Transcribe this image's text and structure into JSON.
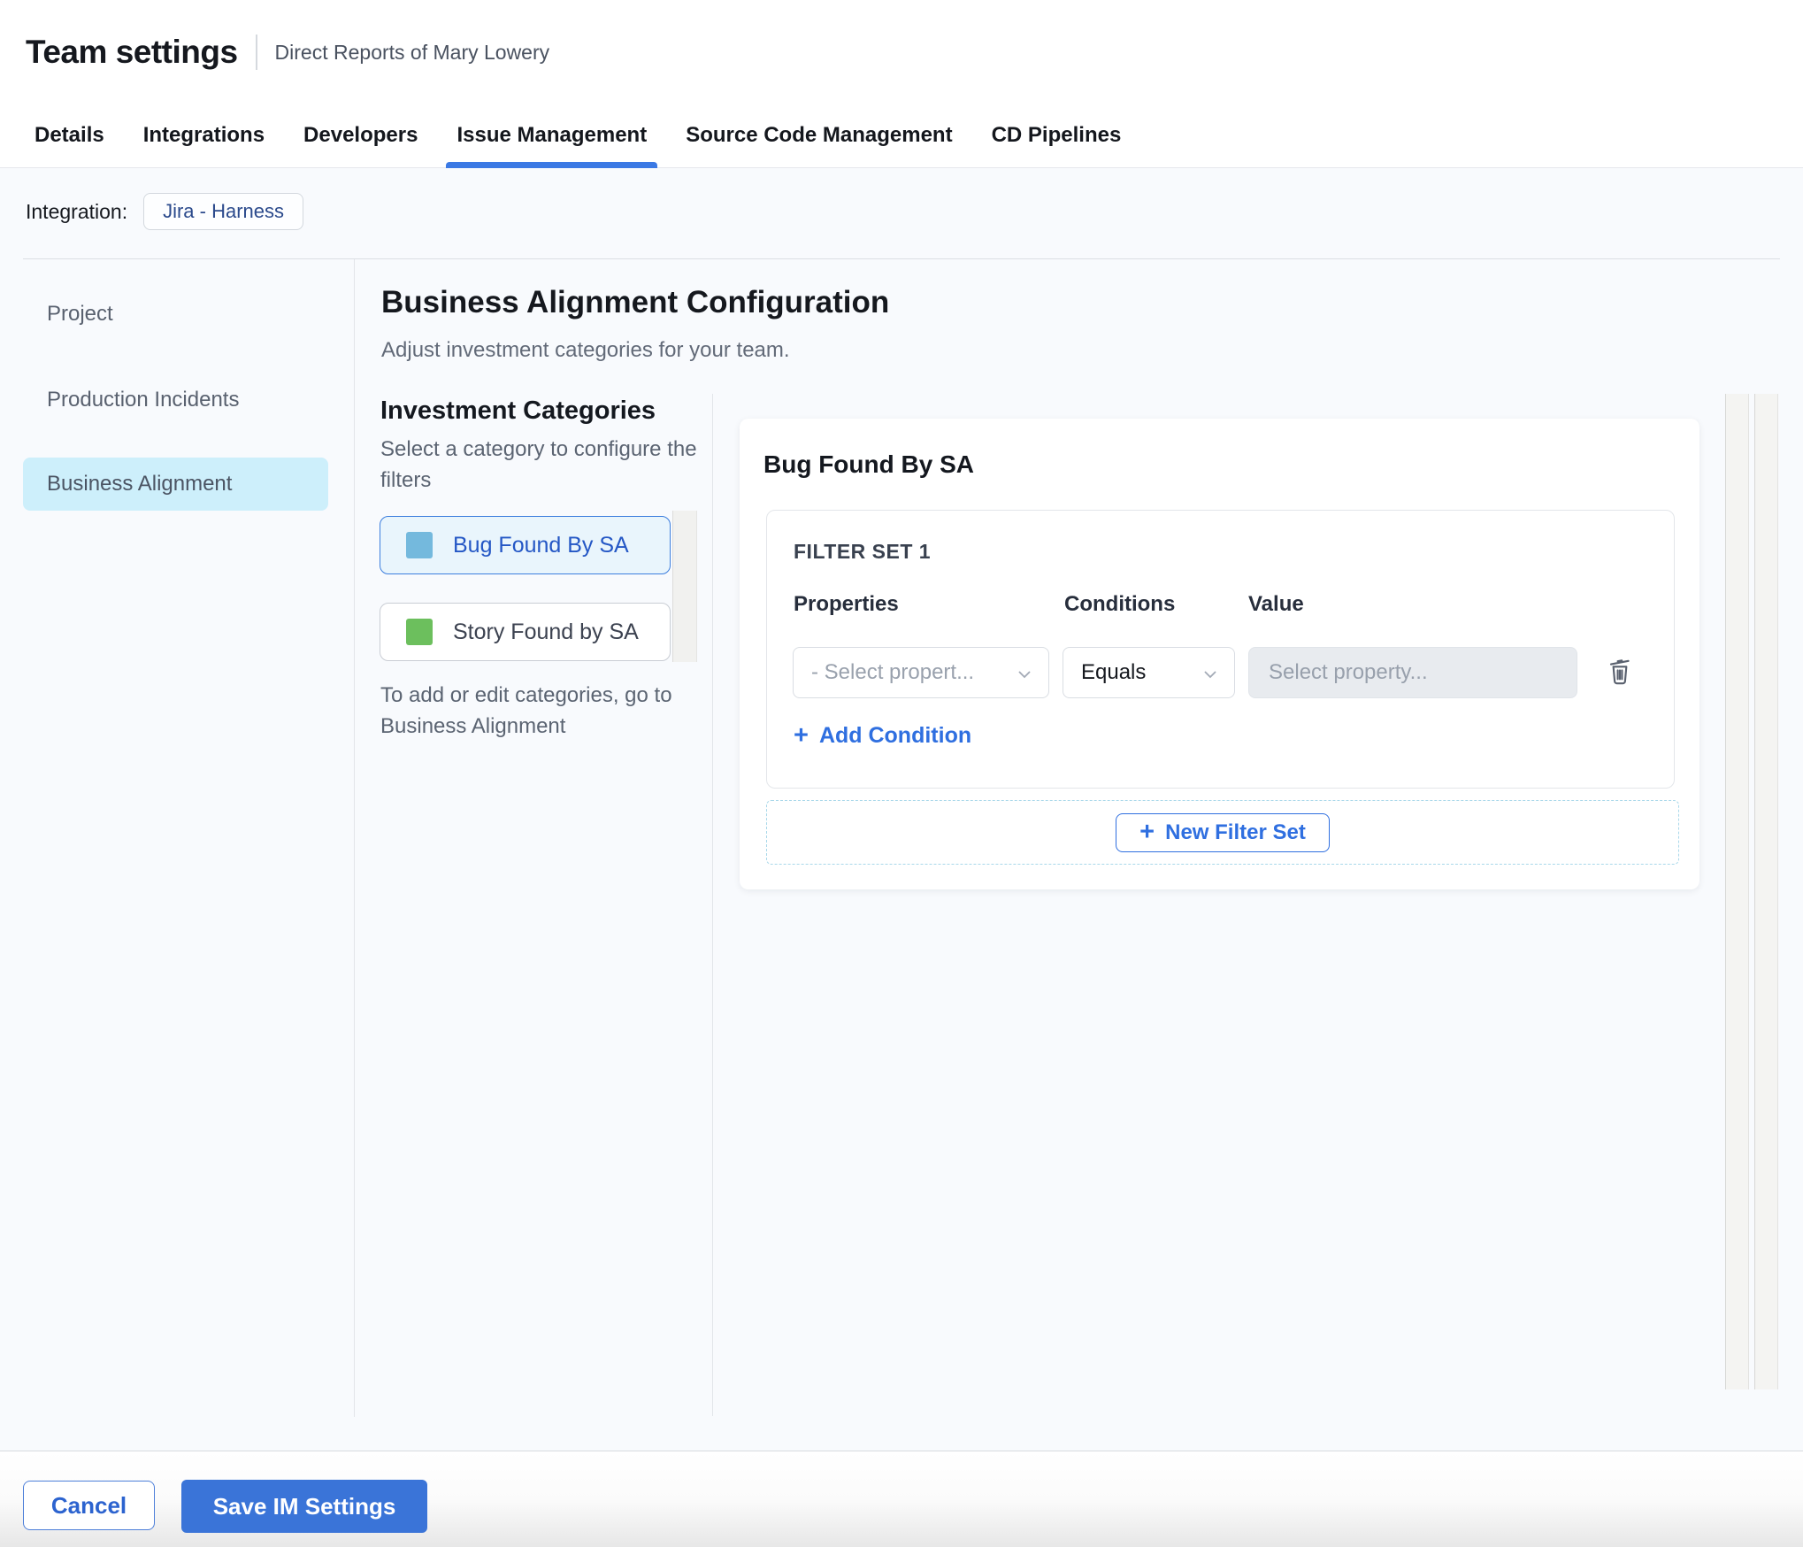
{
  "header": {
    "title": "Team settings",
    "subtitle": "Direct Reports of Mary Lowery"
  },
  "tabs": {
    "items": [
      {
        "label": "Details"
      },
      {
        "label": "Integrations"
      },
      {
        "label": "Developers"
      },
      {
        "label": "Issue Management"
      },
      {
        "label": "Source Code Management"
      },
      {
        "label": "CD Pipelines"
      }
    ],
    "active": "Issue Management"
  },
  "integration": {
    "label": "Integration:",
    "value": "Jira - Harness"
  },
  "sidebar": {
    "items": [
      {
        "label": "Project"
      },
      {
        "label": "Production Incidents"
      },
      {
        "label": "Business Alignment"
      }
    ],
    "active": "Business Alignment"
  },
  "main": {
    "title": "Business Alignment Configuration",
    "subtitle": "Adjust investment categories for your team."
  },
  "categories": {
    "title": "Investment Categories",
    "description": "Select a category to configure the filters",
    "items": [
      {
        "label": "Bug Found By SA",
        "color": "#74b9dd",
        "selected": true
      },
      {
        "label": "Story Found by SA",
        "color": "#6cbf5d",
        "selected": false
      }
    ],
    "note": "To add or edit categories, go to Business Alignment"
  },
  "filter_panel": {
    "title": "Bug Found By SA",
    "filter_set_title": "FILTER SET 1",
    "columns": {
      "properties": "Properties",
      "conditions": "Conditions",
      "value": "Value"
    },
    "property_placeholder": "- Select propert...",
    "condition_value": "Equals",
    "value_placeholder": "Select property...",
    "add_condition": "Add Condition",
    "new_filter_set": "New Filter Set"
  },
  "footer": {
    "cancel": "Cancel",
    "save": "Save IM Settings"
  },
  "icons": {
    "plus": "+"
  },
  "colors": {
    "accent": "#2f6fe0",
    "tab_underline": "#3b79e4",
    "save_button": "#3a74d8",
    "content_bg": "#f8fafd",
    "sidebar_active_bg": "#cdeffb",
    "selected_category_bg": "#e9f5fc",
    "selected_category_border": "#3c7ede",
    "bug_swatch": "#74b9dd",
    "story_swatch": "#6cbf5d"
  }
}
